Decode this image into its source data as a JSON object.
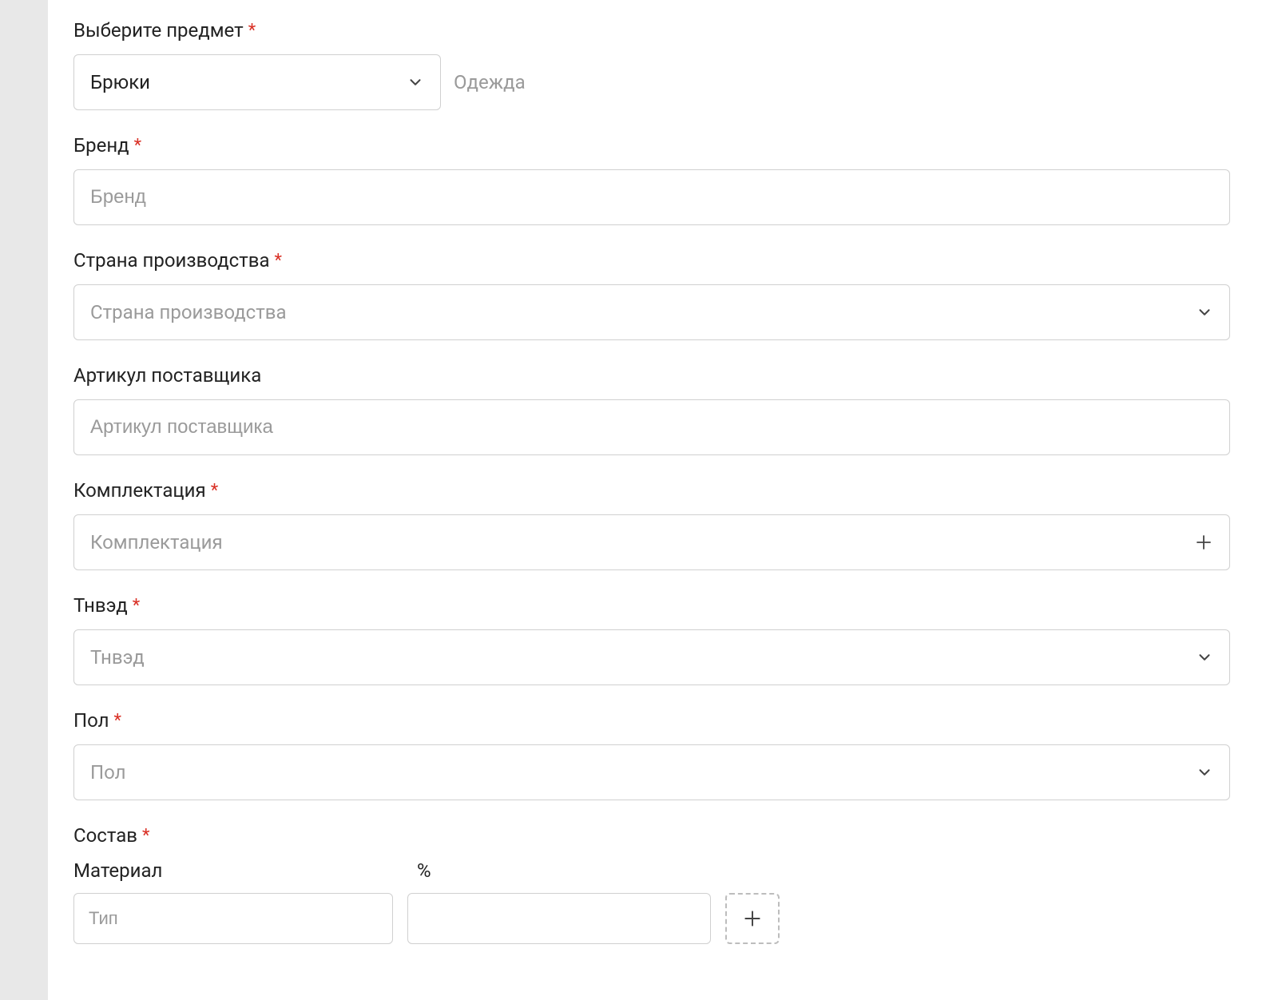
{
  "fields": {
    "subject": {
      "label": "Выберите предмет",
      "value": "Брюки",
      "helper": "Одежда"
    },
    "brand": {
      "label": "Бренд",
      "placeholder": "Бренд"
    },
    "country": {
      "label": "Страна производства",
      "placeholder": "Страна производства"
    },
    "supplier_sku": {
      "label": "Артикул поставщика",
      "placeholder": "Артикул поставщика"
    },
    "kit": {
      "label": "Комплектация",
      "placeholder": "Комплектация"
    },
    "tnved": {
      "label": "Тнвэд",
      "placeholder": "Тнвэд"
    },
    "gender": {
      "label": "Пол",
      "placeholder": "Пол"
    },
    "composition": {
      "label": "Состав",
      "material_label": "Материал",
      "percent_label": "%",
      "material_placeholder": "Тип"
    }
  },
  "required_mark": "*"
}
